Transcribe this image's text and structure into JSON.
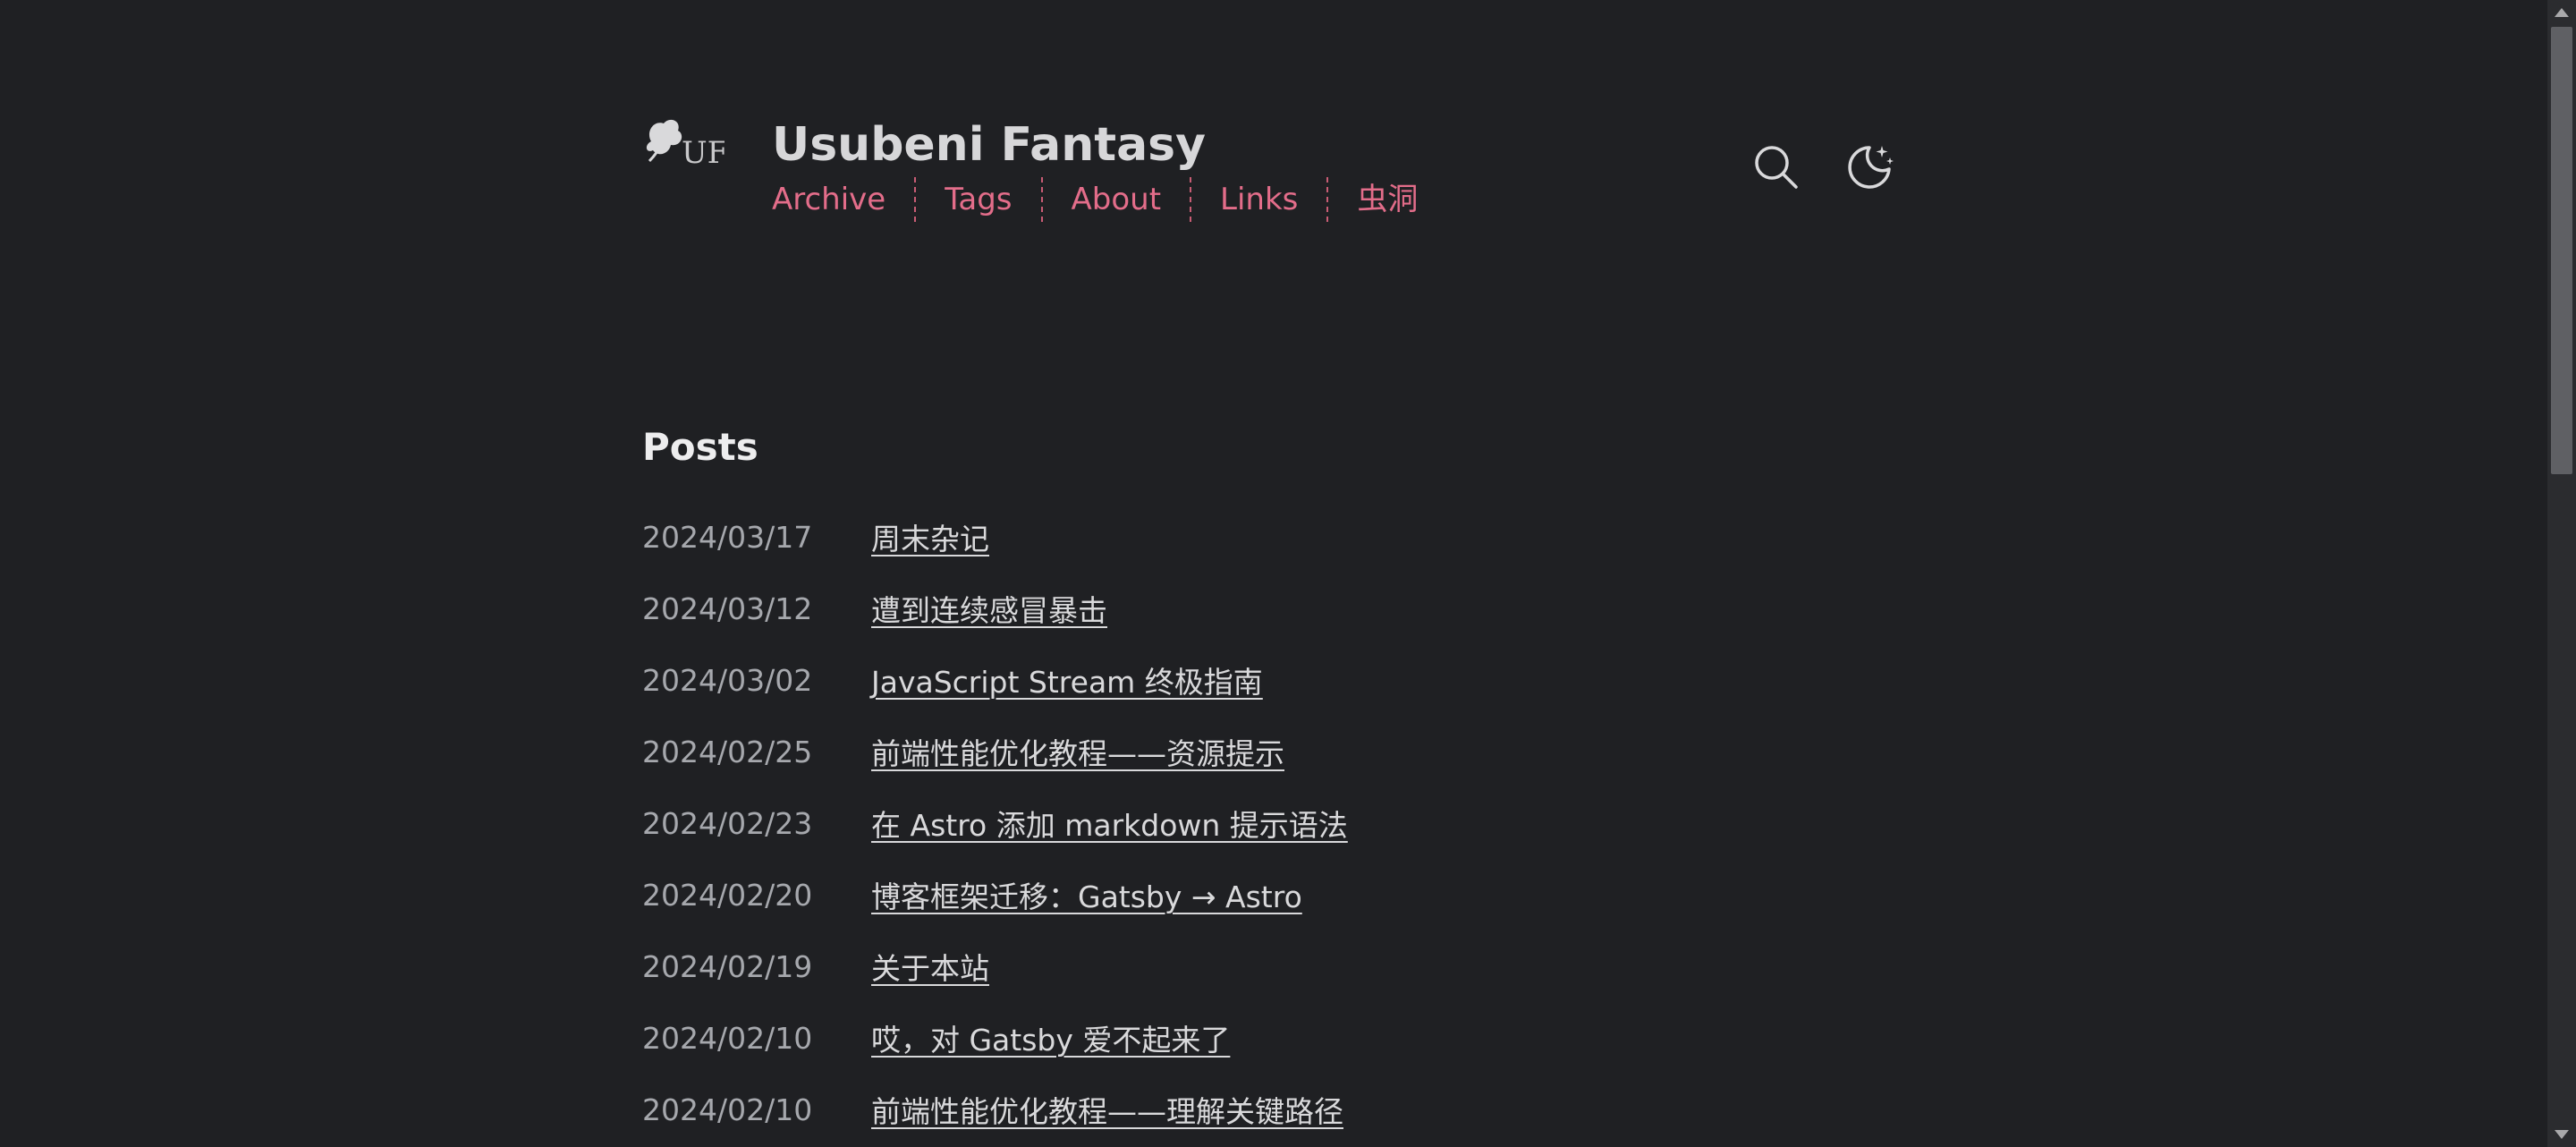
{
  "header": {
    "logo_text": "UF",
    "title": "Usubeni Fantasy",
    "nav": [
      "Archive",
      "Tags",
      "About",
      "Links",
      "虫洞"
    ]
  },
  "icons": {
    "search": "search-icon",
    "theme": "moon-icon"
  },
  "colors": {
    "background": "#1f2023",
    "accent": "#e36d8a",
    "title": "#d7d7d9",
    "date": "#a6a8ad"
  },
  "posts": {
    "heading": "Posts",
    "items": [
      {
        "date": "2024/03/17",
        "title": "周末杂记"
      },
      {
        "date": "2024/03/12",
        "title": "遭到连续感冒暴击"
      },
      {
        "date": "2024/03/02",
        "title": "JavaScript Stream 终极指南"
      },
      {
        "date": "2024/02/25",
        "title": "前端性能优化教程——资源提示"
      },
      {
        "date": "2024/02/23",
        "title": "在 Astro 添加 markdown 提示语法"
      },
      {
        "date": "2024/02/20",
        "title": "博客框架迁移：Gatsby → Astro"
      },
      {
        "date": "2024/02/19",
        "title": "关于本站"
      },
      {
        "date": "2024/02/10",
        "title": "哎，对 Gatsby 爱不起来了"
      },
      {
        "date": "2024/02/10",
        "title": "前端性能优化教程——理解关键路径"
      }
    ]
  }
}
